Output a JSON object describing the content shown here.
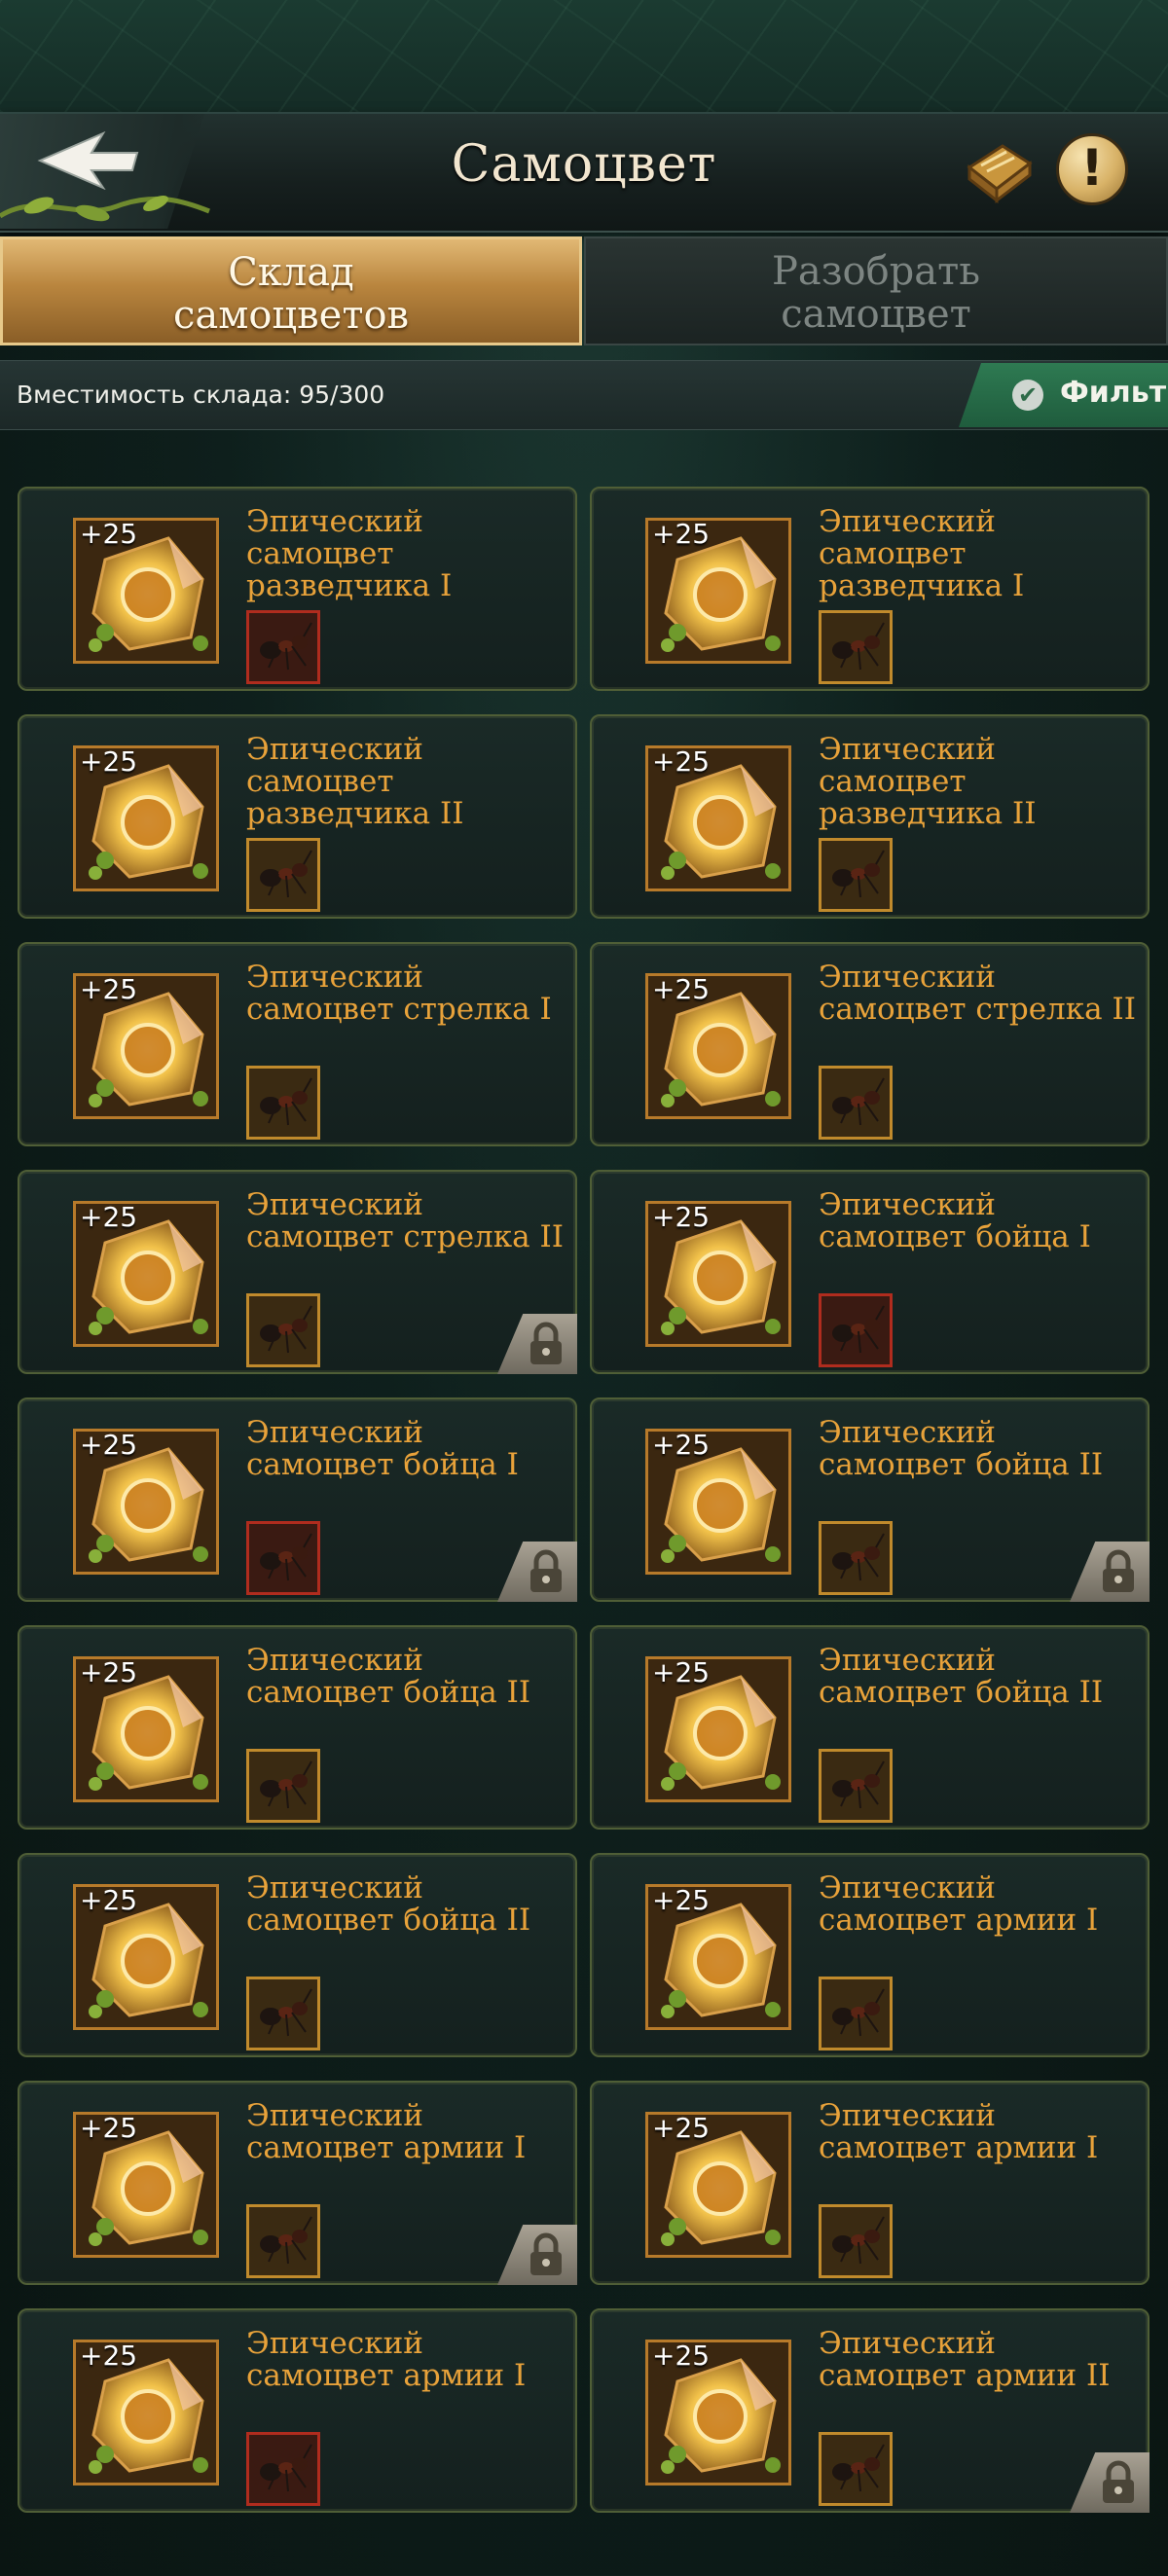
{
  "header": {
    "title": "Самоцвет"
  },
  "tabs": [
    {
      "label_line1": "Склад",
      "label_line2": "самоцветов",
      "active": true
    },
    {
      "label_line1": "Разобрать",
      "label_line2": "самоцвет",
      "active": false
    }
  ],
  "storage": {
    "capacity_text": "Вместимость склада: 95/300"
  },
  "filter": {
    "label": "Фильт"
  },
  "icons": {
    "back": "back-arrow-icon",
    "book": "book-icon",
    "info": "info-icon",
    "check": "check-icon",
    "lock": "lock-icon"
  },
  "colors": {
    "accent_gold": "#e8a23a",
    "filter_green": "#2e7a52",
    "frame_gold": "#c08a2c",
    "frame_red": "#b02c1e"
  },
  "gems": [
    {
      "level": "+25",
      "name": "Эпический самоцвет разведчика I",
      "ant_frame": "red",
      "locked": false
    },
    {
      "level": "+25",
      "name": "Эпический самоцвет разведчика I",
      "ant_frame": "gold",
      "locked": false
    },
    {
      "level": "+25",
      "name": "Эпический самоцвет разведчика II",
      "ant_frame": "gold",
      "locked": false
    },
    {
      "level": "+25",
      "name": "Эпический самоцвет разведчика II",
      "ant_frame": "gold",
      "locked": false
    },
    {
      "level": "+25",
      "name": "Эпический самоцвет стрелка I",
      "ant_frame": "gold",
      "locked": false
    },
    {
      "level": "+25",
      "name": "Эпический самоцвет стрелка II",
      "ant_frame": "gold",
      "locked": false
    },
    {
      "level": "+25",
      "name": "Эпический самоцвет стрелка II",
      "ant_frame": "gold",
      "locked": true
    },
    {
      "level": "+25",
      "name": "Эпический самоцвет бойца I",
      "ant_frame": "red",
      "locked": false
    },
    {
      "level": "+25",
      "name": "Эпический самоцвет бойца I",
      "ant_frame": "red",
      "locked": true
    },
    {
      "level": "+25",
      "name": "Эпический самоцвет бойца II",
      "ant_frame": "gold",
      "locked": true
    },
    {
      "level": "+25",
      "name": "Эпический самоцвет бойца II",
      "ant_frame": "gold",
      "locked": false
    },
    {
      "level": "+25",
      "name": "Эпический самоцвет бойца II",
      "ant_frame": "gold",
      "locked": false
    },
    {
      "level": "+25",
      "name": "Эпический самоцвет бойца II",
      "ant_frame": "gold",
      "locked": false
    },
    {
      "level": "+25",
      "name": "Эпический самоцвет армии I",
      "ant_frame": "gold",
      "locked": false
    },
    {
      "level": "+25",
      "name": "Эпический самоцвет армии I",
      "ant_frame": "gold",
      "locked": true
    },
    {
      "level": "+25",
      "name": "Эпический самоцвет армии I",
      "ant_frame": "gold",
      "locked": false
    },
    {
      "level": "+25",
      "name": "Эпический самоцвет армии I",
      "ant_frame": "red",
      "locked": false
    },
    {
      "level": "+25",
      "name": "Эпический самоцвет армии II",
      "ant_frame": "gold",
      "locked": true
    }
  ]
}
